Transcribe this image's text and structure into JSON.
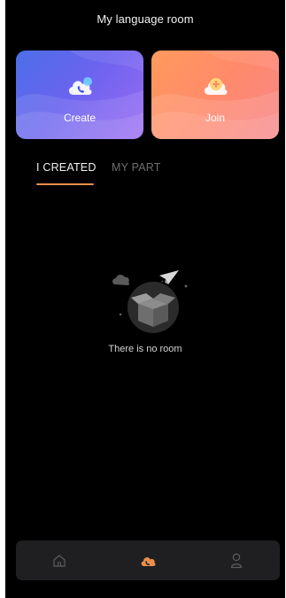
{
  "header": {
    "title": "My language room"
  },
  "cards": {
    "create": {
      "label": "Create",
      "icon": "phone-cloud-icon"
    },
    "join": {
      "label": "Join",
      "icon": "plus-cloud-icon"
    }
  },
  "tabs": {
    "items": [
      {
        "label": "I CREATED",
        "active": true
      },
      {
        "label": "MY PART",
        "active": false
      }
    ]
  },
  "empty_state": {
    "message": "There is no room",
    "icon": "empty-box-icon"
  },
  "bottom_nav": {
    "items": [
      {
        "icon": "home-icon",
        "active": false
      },
      {
        "icon": "cloud-room-icon",
        "active": true
      },
      {
        "icon": "profile-icon",
        "active": false
      }
    ]
  },
  "colors": {
    "background": "#000000",
    "accent": "#e98e4c",
    "create_gradient": [
      "#4c6fe8",
      "#9b6bf2"
    ],
    "join_gradient": [
      "#ff9a5c",
      "#f7858a"
    ],
    "nav_background": "#1f1f21"
  }
}
